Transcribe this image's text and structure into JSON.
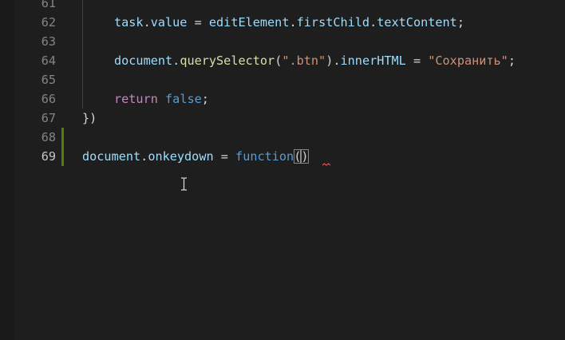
{
  "lines": [
    {
      "num": "61",
      "tokens": []
    },
    {
      "num": "62",
      "tokens": [
        {
          "t": "task",
          "c": "var"
        },
        {
          "t": ".",
          "c": "punc"
        },
        {
          "t": "value",
          "c": "var"
        },
        {
          "t": " = ",
          "c": "punc"
        },
        {
          "t": "editElement",
          "c": "var"
        },
        {
          "t": ".",
          "c": "punc"
        },
        {
          "t": "firstChild",
          "c": "var"
        },
        {
          "t": ".",
          "c": "punc"
        },
        {
          "t": "textContent",
          "c": "var"
        },
        {
          "t": ";",
          "c": "punc"
        }
      ]
    },
    {
      "num": "63",
      "tokens": []
    },
    {
      "num": "64",
      "tokens": [
        {
          "t": "document",
          "c": "var"
        },
        {
          "t": ".",
          "c": "punc"
        },
        {
          "t": "querySelector",
          "c": "fn"
        },
        {
          "t": "(",
          "c": "punc"
        },
        {
          "t": "\".btn\"",
          "c": "str"
        },
        {
          "t": ").",
          "c": "punc"
        },
        {
          "t": "innerHTML",
          "c": "var"
        },
        {
          "t": " = ",
          "c": "punc"
        },
        {
          "t": "\"Сохранить\"",
          "c": "str"
        },
        {
          "t": ";",
          "c": "punc"
        }
      ]
    },
    {
      "num": "65",
      "tokens": []
    },
    {
      "num": "66",
      "tokens": [
        {
          "t": "return",
          "c": "kw-ctl"
        },
        {
          "t": " ",
          "c": "punc"
        },
        {
          "t": "false",
          "c": "kw"
        },
        {
          "t": ";",
          "c": "punc"
        }
      ]
    },
    {
      "num": "67",
      "tokens": [
        {
          "t": "})",
          "c": "punc"
        }
      ]
    },
    {
      "num": "68",
      "tokens": []
    },
    {
      "num": "69",
      "tokens": [
        {
          "t": "document",
          "c": "var"
        },
        {
          "t": ".",
          "c": "punc"
        },
        {
          "t": "onkeydown",
          "c": "var"
        },
        {
          "t": " = ",
          "c": "punc"
        },
        {
          "t": "function",
          "c": "kw"
        },
        {
          "t": "(",
          "c": "punc",
          "m": 1
        },
        {
          "t": ")",
          "c": "punc",
          "m": 1
        }
      ]
    }
  ],
  "active_line": "69",
  "modified_lines": [
    "68",
    "69"
  ],
  "colors": {
    "background": "#1e1e1e",
    "variable": "#9cdcfe",
    "function": "#dcdcaa",
    "string": "#ce9178",
    "control_keyword": "#c586c0",
    "keyword": "#569cd6",
    "modified_bar": "#587c0c",
    "error_squiggle": "#f14c4c"
  }
}
